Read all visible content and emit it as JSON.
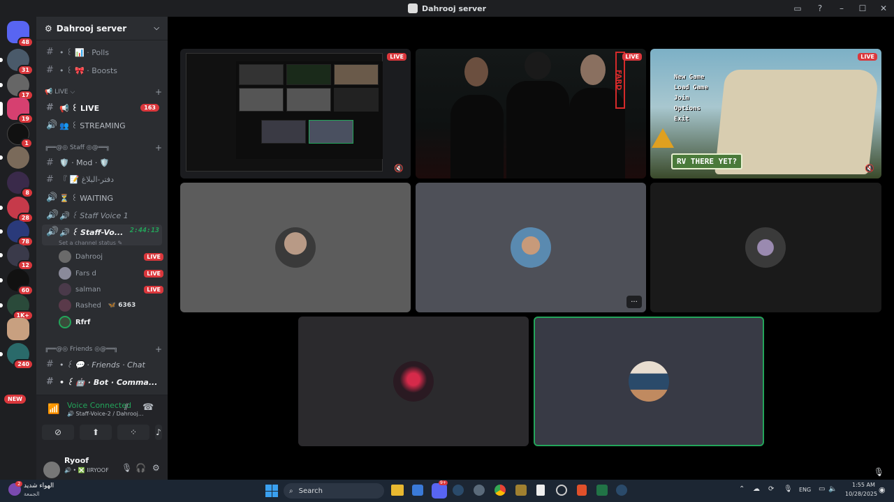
{
  "window": {
    "title": "Dahrooj server"
  },
  "rail": {
    "badges": [
      "48",
      "31",
      "17",
      "19",
      "1",
      "8",
      "28",
      "78",
      "12",
      "60",
      "1K+",
      "240"
    ],
    "new_label": "NEW"
  },
  "server": {
    "name": "Dahrooj server"
  },
  "channels": {
    "polls": "• ꒰ 📊 · Polls",
    "boosts": "• ꒰ 🎀 · Boosts",
    "cat_live": "📢 LIVE ⌵",
    "live": "📢 ꒰ LIVE",
    "live_count": "163",
    "streaming": "👥 ꒰ STREAMING",
    "cat_staff": "╔══@◎ Staff ◎@══╗",
    "mod": "🛡️ · Mod · 🛡️",
    "notes": "『 📝 دفتر-البلاغ",
    "waiting": "⏳ ꒰ WAITING",
    "staff_voice1": "🔊 ꒰ Staff Voice 1",
    "staff_voice2": "🔊 ꒰ Staff-Vo...",
    "staff_voice2_timer": "2:44:13",
    "status_hint": "Set a channel status ✎",
    "cat_friends": "╔══@◎ Friends ◎@══╗",
    "friends_chat": "• ꒰ 💬 · Friends · Chat",
    "bot_commands": "• ꒰ 🤖 · Bot · Comma..."
  },
  "voice_users": [
    {
      "name": "Dahrooj",
      "live": "LIVE"
    },
    {
      "name": "Fars d",
      "live": "LIVE"
    },
    {
      "name": "salman",
      "live": "LIVE"
    },
    {
      "name": "Rashed",
      "extra": "🦋 6363"
    },
    {
      "name": "Rfrf"
    }
  ],
  "voice_panel": {
    "title": "Voice Connected",
    "subtitle": "🔊 Staff-Voice-2 / Dahrooj..."
  },
  "user_panel": {
    "name": "Ryoof",
    "sub": "🔊 • ❎ IIRYOOF"
  },
  "stream_tiles": [
    {
      "live": "LIVE"
    },
    {
      "live": "LIVE",
      "neon_text": "FARD"
    },
    {
      "live": "LIVE",
      "menu": [
        "New Game",
        "Load Game",
        "Join",
        "Options",
        "Exit"
      ],
      "logo": "RV THERE YET?"
    }
  ],
  "colors": {
    "accent_green": "#23a55a",
    "live_red": "#da373c"
  },
  "taskbar": {
    "weather_text": "الهواء شديد",
    "weather_sub": "الجمعة",
    "weather_badge": "2",
    "search_placeholder": "Search",
    "lang": "ENG",
    "time": "1:55 AM",
    "date": "10/28/2025",
    "discord_badge": "9+"
  }
}
